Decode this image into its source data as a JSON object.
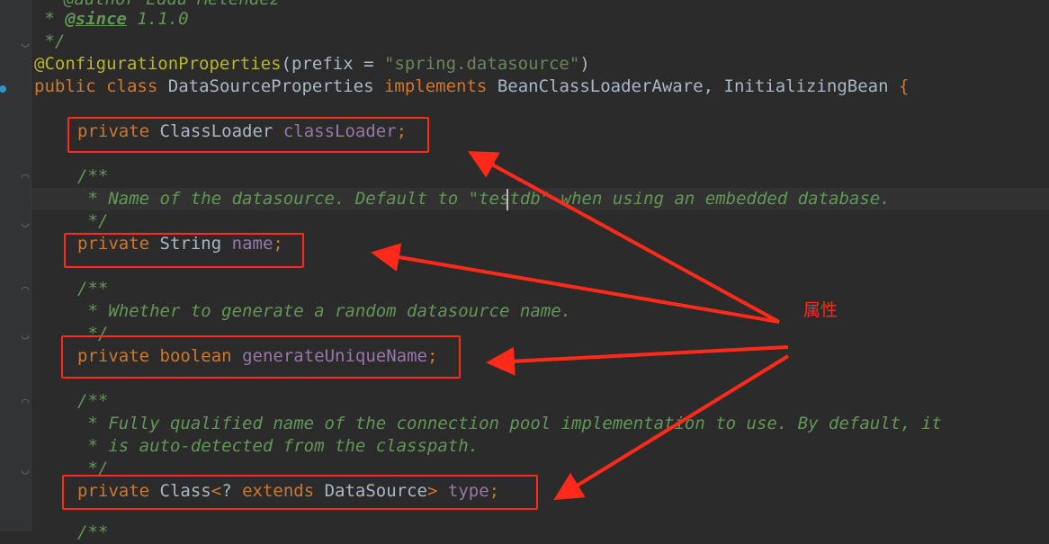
{
  "code_lines": {
    "l0": "* @author Eddú Meléndez",
    "l1_prefix": " * ",
    "l1_tag": "@since",
    "l1_rest": " 1.1.0",
    "l2": " */",
    "annotation": "@ConfigurationProperties",
    "ann_open": "(",
    "ann_attr": "prefix",
    "ann_eq": " = ",
    "ann_value": "\"spring.datasource\"",
    "ann_close": ")",
    "class_public": "public",
    "class_class": "class",
    "class_name": "DataSourceProperties",
    "class_implements": "implements",
    "class_iface1": "BeanClassLoaderAware,",
    "class_iface2": "InitializingBean",
    "class_brace": "{",
    "f1_mod": "private",
    "f1_type": "ClassLoader",
    "f1_name": "classLoader",
    "f1_semi": ";",
    "d1_open": "/**",
    "d1_text": " * Name of the datasource. Default to \"testdb\" when using an embedded database.",
    "d1_close": " */",
    "f2_mod": "private",
    "f2_type": "String",
    "f2_name": "name",
    "f2_semi": ";",
    "d2_open": "/**",
    "d2_text": " * Whether to generate a random datasource name.",
    "d2_close": " */",
    "f3_mod": "private",
    "f3_type": "boolean",
    "f3_name": "generateUniqueName",
    "f3_semi": ";",
    "d3_open": "/**",
    "d3_text1": " * Fully qualified name of the connection pool implementation to use. By default, it",
    "d3_text2": " * is auto-detected from the classpath.",
    "d3_close": " */",
    "f4_mod": "private",
    "f4_type": "Class",
    "f4_lt": "<",
    "f4_q": "? ",
    "f4_extends": "extends",
    "f4_bound": " DataSource",
    "f4_gt": ">",
    "f4_name": "type",
    "f4_semi": ";",
    "tail": "/**"
  },
  "annotation_label": "属性",
  "colors": {
    "background": "#2b2b2b",
    "keyword": "#cc7832",
    "field": "#9876aa",
    "string": "#6a8759",
    "annotation": "#bbb529",
    "doc_comment": "#629755",
    "highlight": "#ff2a1a"
  },
  "icons": [
    "fold-marker-icon",
    "run-gutter-icon"
  ]
}
